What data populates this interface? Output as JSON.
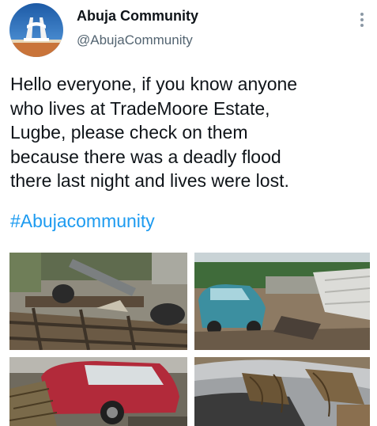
{
  "tweet": {
    "display_name": "Abuja Community",
    "handle": "@AbujaCommunity",
    "text": "Hello everyone, if you know anyone\nwho lives at TradeMoore Estate,\nLugbe, please check on them\nbecause there was a deadly flood\nthere last night and lives were lost.",
    "hashtag": "#Abujacommunity",
    "more_icon": "more-vertical-icon",
    "colors": {
      "name": "#0f1419",
      "handle": "#536471",
      "hashtag": "#1d9bf0"
    }
  },
  "media": [
    {
      "icon": "photo-flood-debris"
    },
    {
      "icon": "photo-car-collapsed-wall"
    },
    {
      "icon": "photo-red-car"
    },
    {
      "icon": "photo-car-hood-mud"
    }
  ]
}
